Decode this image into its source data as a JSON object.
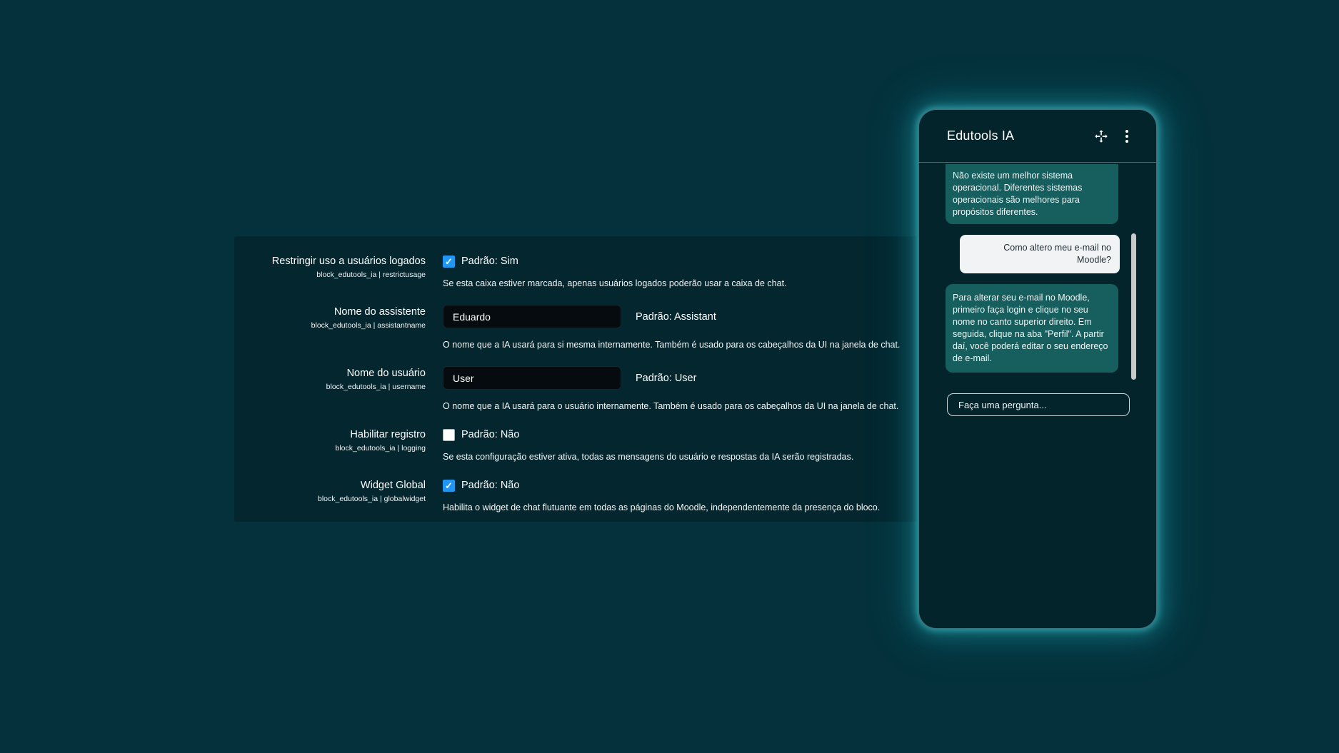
{
  "settings": {
    "rows": [
      {
        "label": "Restringir uso a usuários logados",
        "plugin": "block_edutools_ia | restrictusage",
        "type": "checkbox",
        "checked": true,
        "default_label": "Padrão: Sim",
        "description": "Se esta caixa estiver marcada, apenas usuários logados poderão usar a caixa de chat."
      },
      {
        "label": "Nome do assistente",
        "plugin": "block_edutools_ia | assistantname",
        "type": "text",
        "value": "Eduardo",
        "default_label": "Padrão: Assistant",
        "description": "O nome que a IA usará para si mesma internamente. Também é usado para os cabeçalhos da UI na janela de chat."
      },
      {
        "label": "Nome do usuário",
        "plugin": "block_edutools_ia | username",
        "type": "text",
        "value": "User",
        "default_label": "Padrão: User",
        "description": "O nome que a IA usará para o usuário internamente. Também é usado para os cabeçalhos da UI na janela de chat."
      },
      {
        "label": "Habilitar registro",
        "plugin": "block_edutools_ia | logging",
        "type": "checkbox",
        "checked": false,
        "default_label": "Padrão: Não",
        "description": "Se esta configuração estiver ativa, todas as mensagens do usuário e respostas da IA serão registradas."
      },
      {
        "label": "Widget Global",
        "plugin": "block_edutools_ia | globalwidget",
        "type": "checkbox",
        "checked": true,
        "default_label": "Padrão: Não",
        "description": "Habilita o widget de chat flutuante em todas as páginas do Moodle, independentemente da presença do bloco."
      }
    ]
  },
  "chat": {
    "title": "Edutools IA",
    "icons": {
      "move": "move-icon",
      "menu": "kebab-menu-icon"
    },
    "messages": [
      {
        "role": "assistant",
        "text": "Não existe um melhor sistema operacional. Diferentes sistemas operacionais são melhores para propósitos diferentes."
      },
      {
        "role": "user",
        "text": "Como altero meu e-mail no Moodle?"
      },
      {
        "role": "assistant",
        "text": "Para alterar seu e-mail no Moodle, primeiro faça login e clique no seu nome no canto superior direito. Em seguida, clique na aba \"Perfil\". A partir daí, você poderá editar o seu endereço de e-mail."
      }
    ],
    "input_placeholder": "Faça uma pergunta..."
  },
  "colors": {
    "page_background": "#04313b",
    "panel_background": "#03262f",
    "widget_background": "#04242c",
    "assistant_bubble": "#175f5e",
    "user_bubble": "#f1f3f4",
    "checkbox_checked": "#2196f3",
    "widget_glow": "#35d4de",
    "scrollbar_thumb": "#c6caca"
  }
}
